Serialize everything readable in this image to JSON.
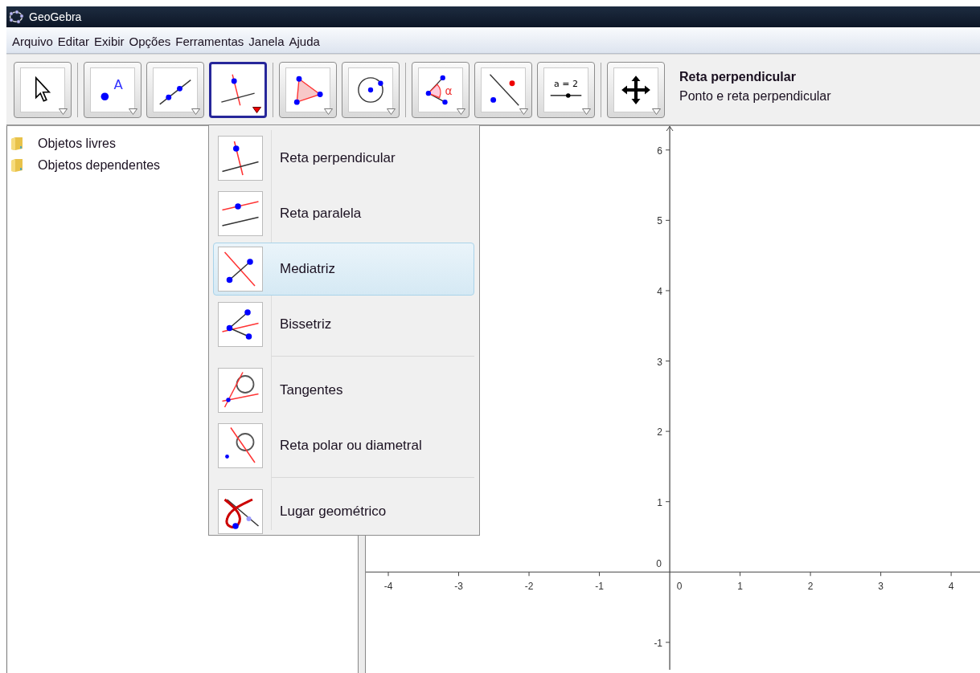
{
  "window": {
    "title": "GeoGebra"
  },
  "menu_bar": [
    "Arquivo",
    "Editar",
    "Exibir",
    "Opções",
    "Ferramentas",
    "Janela",
    "Ajuda"
  ],
  "toolbar": {
    "groups": [
      {
        "buttons": [
          {
            "kind": "move",
            "selected": false
          }
        ]
      },
      {
        "buttons": [
          {
            "kind": "point",
            "glyph": "A",
            "selected": false
          },
          {
            "kind": "line",
            "selected": false
          },
          {
            "kind": "perpendicular",
            "selected": true
          }
        ]
      },
      {
        "buttons": [
          {
            "kind": "polygon",
            "selected": false
          },
          {
            "kind": "circle",
            "selected": false
          }
        ]
      },
      {
        "buttons": [
          {
            "kind": "angle",
            "glyph": "α",
            "selected": false
          },
          {
            "kind": "reflect",
            "selected": false
          },
          {
            "kind": "slider",
            "glyph": "a = 2",
            "selected": false
          }
        ]
      },
      {
        "buttons": [
          {
            "kind": "translate",
            "selected": false
          }
        ]
      }
    ],
    "tool_name": "Reta perpendicular",
    "tool_help": "Ponto e reta perpendicular"
  },
  "algebra_view": {
    "folders": [
      "Objetos livres",
      "Objetos dependentes"
    ]
  },
  "tool_menu": {
    "groups": [
      {
        "items": [
          {
            "kind": "perpendicular",
            "label": "Reta perpendicular",
            "selected": false
          },
          {
            "kind": "parallel",
            "label": "Reta paralela",
            "selected": false
          },
          {
            "kind": "bisector",
            "label": "Mediatriz",
            "selected": true
          },
          {
            "kind": "angle_bisector",
            "label": "Bissetriz",
            "selected": false
          }
        ]
      },
      {
        "items": [
          {
            "kind": "tangents",
            "label": "Tangentes",
            "selected": false
          },
          {
            "kind": "polar",
            "label": "Reta polar ou diametral",
            "selected": false
          }
        ]
      },
      {
        "items": [
          {
            "kind": "locus",
            "label": "Lugar geométrico",
            "selected": false
          }
        ]
      }
    ]
  },
  "graphics_view": {
    "origin_x_label": "0",
    "origin_y_label": "0",
    "chart_data": {
      "type": "scatter",
      "xlim": [
        -4.32,
        4.41
      ],
      "ylim": [
        -1.39,
        6.34
      ],
      "xticks": [
        -4,
        -3,
        -2,
        -1,
        1,
        2,
        3,
        4
      ],
      "yticks": [
        -1,
        1,
        2,
        3,
        4,
        5,
        6
      ]
    }
  }
}
